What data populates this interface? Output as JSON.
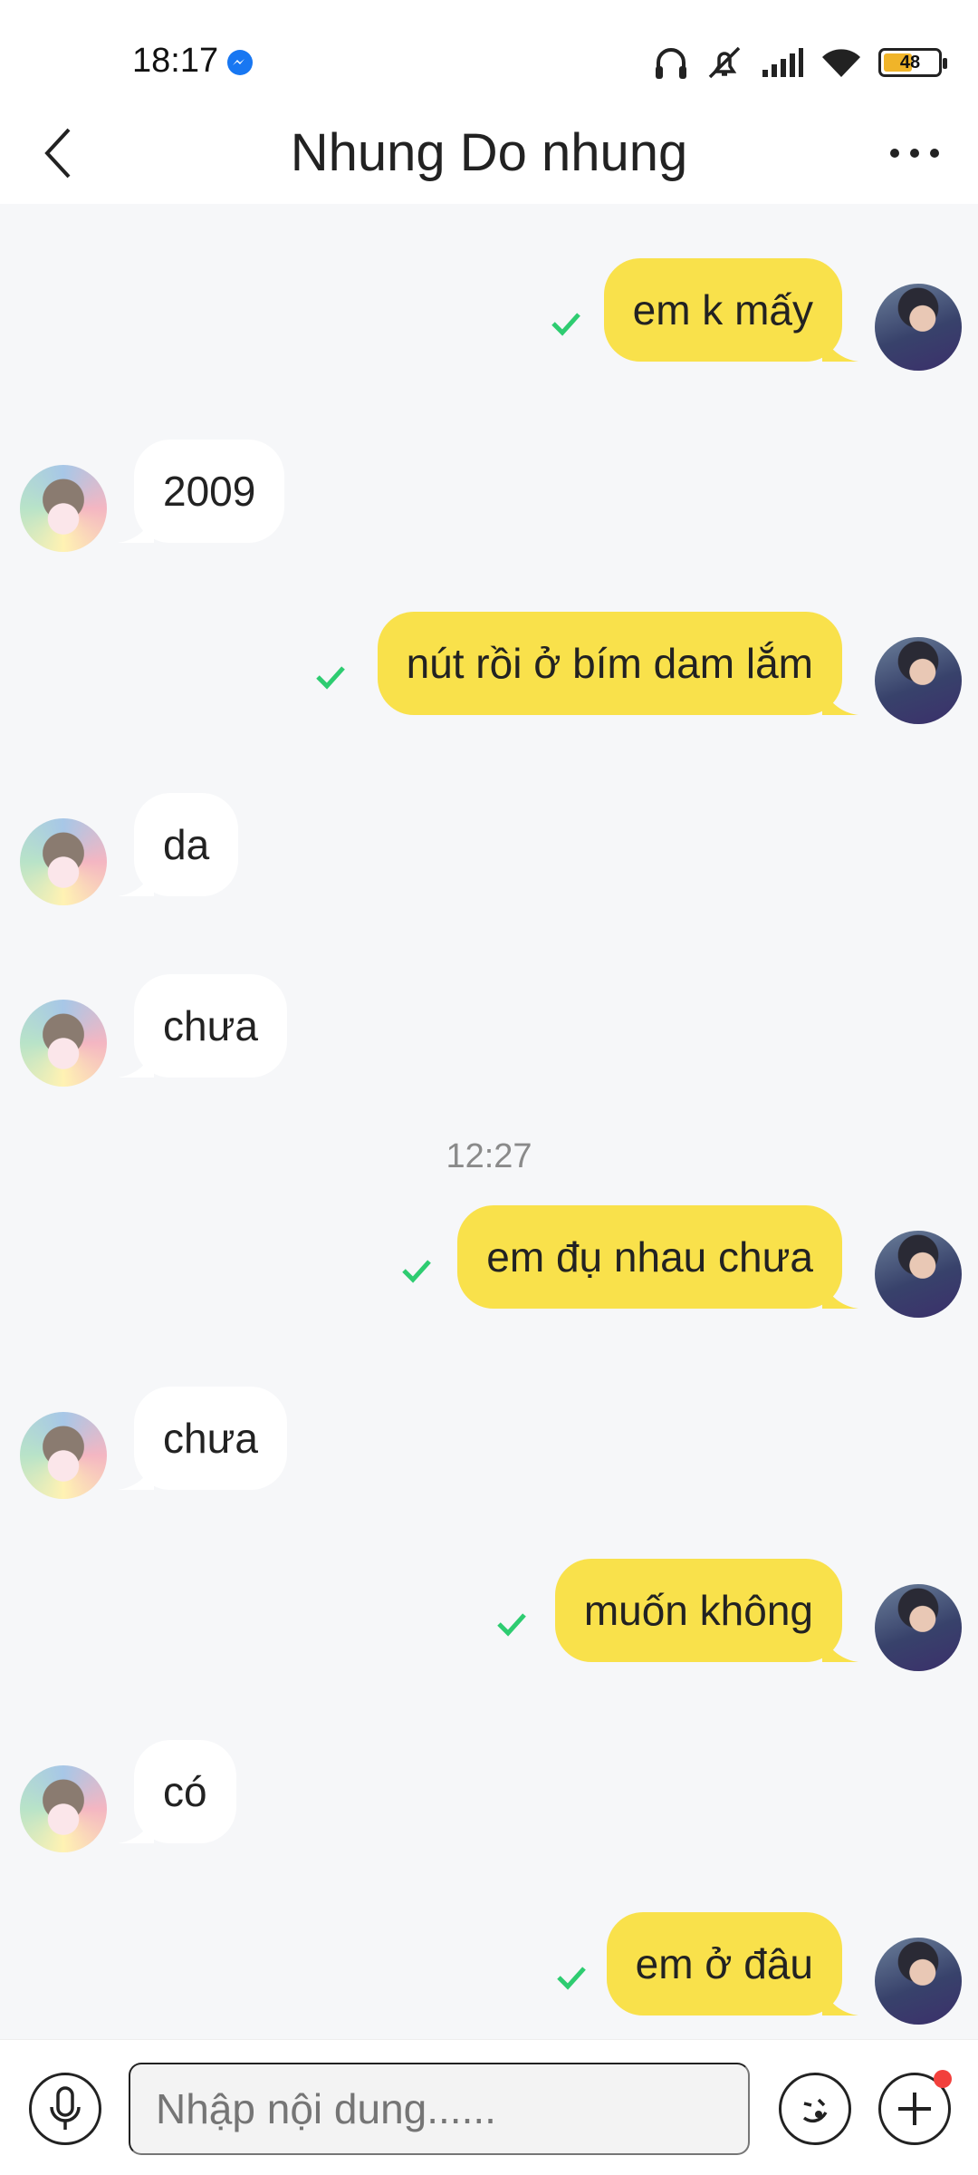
{
  "status_bar": {
    "time": "18:17",
    "battery_level": "48",
    "icons": [
      "messenger-icon",
      "headphones-icon",
      "mute-icon",
      "signal-icon",
      "wifi-icon",
      "battery-icon"
    ]
  },
  "header": {
    "title": "Nhung Do nhung",
    "icons": [
      "back-arrow-icon",
      "more-dots-icon"
    ]
  },
  "messages": [
    {
      "sender": "me",
      "text": "em k mấy",
      "status": "sent-check"
    },
    {
      "sender": "other",
      "text": "2009"
    },
    {
      "sender": "me",
      "text": "nút rồi ở bím dam lắm",
      "status": "sent-check"
    },
    {
      "sender": "other",
      "text": "da"
    },
    {
      "sender": "other",
      "text": "chưa"
    },
    {
      "type": "timestamp",
      "text": "12:27"
    },
    {
      "sender": "me",
      "text": "em đụ nhau chưa",
      "status": "sent-check"
    },
    {
      "sender": "other",
      "text": "chưa"
    },
    {
      "sender": "me",
      "text": "muốn không",
      "status": "sent-check"
    },
    {
      "sender": "other",
      "text": "có"
    },
    {
      "sender": "me",
      "text": "em ở đâu",
      "status": "sent-check"
    }
  ],
  "input_bar": {
    "placeholder": "Nhập nội dung......",
    "icons": [
      "microphone-icon",
      "sticker-icon",
      "plus-icon"
    ]
  },
  "colors": {
    "my_bubble": "#f9e14b",
    "other_bubble": "#ffffff",
    "chat_background": "#f6f7f9",
    "check_mark": "#2ecc71",
    "notification_dot": "#f2403c"
  }
}
